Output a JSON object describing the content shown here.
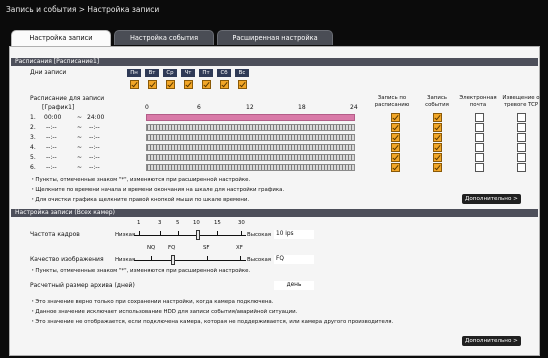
{
  "breadcrumb": "Запись и события > Настройка записи",
  "tabs": [
    "Настройка записи",
    "Настройка события",
    "Расширенная настройка"
  ],
  "schedule": {
    "header": "Расписания [Расписание1]",
    "days_label": "Дни записи",
    "days": [
      "Пн",
      "Вт",
      "Ср",
      "Чт",
      "Пт",
      "Сб",
      "Вс"
    ],
    "sched_label": "Расписание для записи",
    "graph_label": "[График1]",
    "tick_labels": [
      "0",
      "6",
      "12",
      "18",
      "24"
    ],
    "col_sched": "Запись по расписанию",
    "col_event": "Запись события",
    "col_mail": "Электронная почта",
    "col_tcp": "Извещение о тревоге TCP",
    "rows": [
      {
        "num": "1.",
        "start": "00:00",
        "end": "24:00"
      },
      {
        "num": "2.",
        "start": "--:--",
        "end": "--:--"
      },
      {
        "num": "3.",
        "start": "--:--",
        "end": "--:--"
      },
      {
        "num": "4.",
        "start": "--:--",
        "end": "--:--"
      },
      {
        "num": "5.",
        "start": "--:--",
        "end": "--:--"
      },
      {
        "num": "6.",
        "start": "--:--",
        "end": "--:--"
      }
    ],
    "tilde": "~",
    "notes": [
      "・Пункты, отмеченные знаком \"*\", изменяются при расширенной настройке.",
      "・Щелкните по времени начала и времени окончания на шкале для настройки графика.",
      "・Для очистки графика щелкните правой кнопкой мыши по шкале времени."
    ],
    "more_button": "Дополнительно >"
  },
  "rec": {
    "header": "Настройка записи (Всех камер)",
    "fps_label": "Частота кадров",
    "fps_ticks": [
      "1",
      "3",
      "5",
      "10",
      "15",
      "30"
    ],
    "low": "Низкая",
    "high": "Высокая",
    "fps_value": "10 ips",
    "quality_label": "Качество изображения",
    "quality_ticks": [
      "NQ",
      "FQ",
      "SF",
      "XF"
    ],
    "quality_value": "FQ",
    "note": "・Пункты, отмеченные знаком \"*\", изменяются при расширенной настройке.",
    "archive_label": "Расчетный размер архива (дней)",
    "archive_value": "день",
    "notes": [
      "・Это значение верно только при сохранении настройки, когда камера подключена.",
      "・Данное значение исключает использование HDD для записи события/аварийной ситуации.",
      "・Это значение не отображается, если подключена камера, которая не поддерживается, или камера другого производителя."
    ],
    "more_button": "Дополнительно >"
  },
  "colors": {
    "accent": "#f2a626",
    "header": "#4d4f5a",
    "pink": "#d97aa8"
  }
}
